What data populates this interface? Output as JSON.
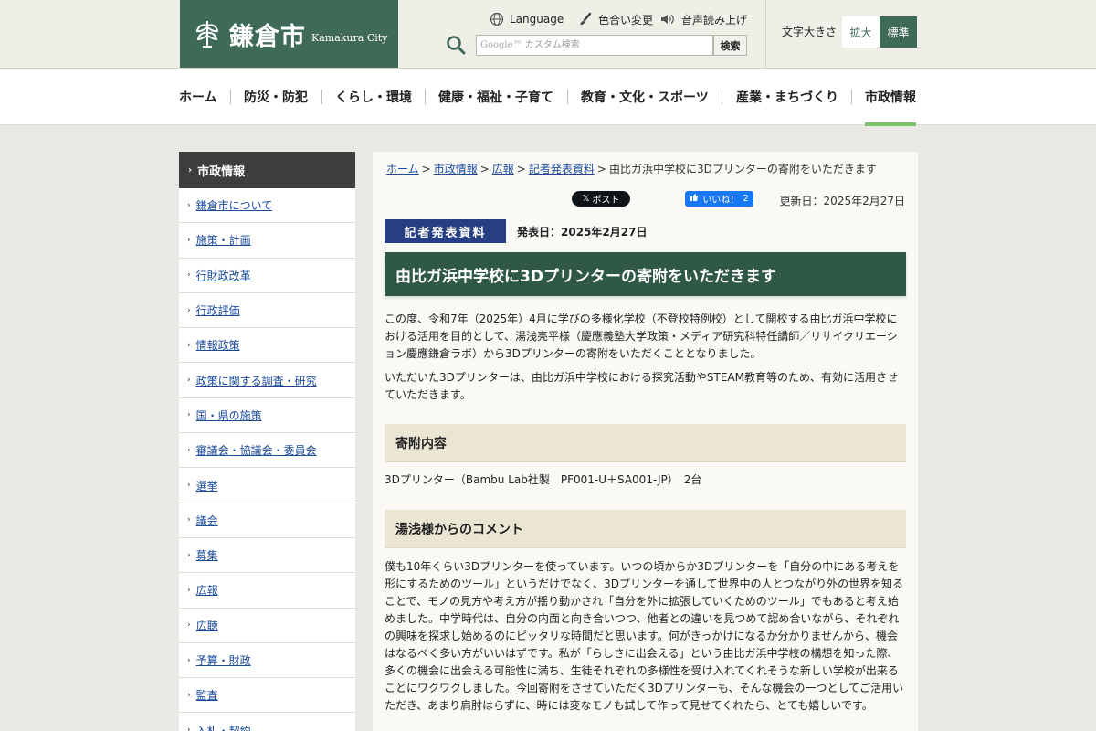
{
  "header": {
    "logo_jp": "鎌倉市",
    "logo_en": "Kamakura City",
    "language": "Language",
    "color_change": "色合い変更",
    "voice_read": "音声読み上げ",
    "search_placeholder": "カスタム検索",
    "search_google_mark": "Google™",
    "search_button": "検索",
    "font_size_label": "文字大きさ",
    "font_large": "拡大",
    "font_standard": "標準"
  },
  "nav": {
    "items": [
      "ホーム",
      "防災・防犯",
      "くらし・環境",
      "健康・福祉・子育て",
      "教育・文化・スポーツ",
      "産業・まちづくり",
      "市政情報"
    ],
    "active": "市政情報",
    "active_color": "#7cc26a"
  },
  "sidebar": {
    "heading": "市政情報",
    "items": [
      "鎌倉市について",
      "施策・計画",
      "行財政改革",
      "行政評価",
      "情報政策",
      "政策に関する調査・研究",
      "国・県の施策",
      "審議会・協議会・委員会",
      "選挙",
      "議会",
      "募集",
      "広報",
      "広聴",
      "予算・財政",
      "監査",
      "入札・契約"
    ]
  },
  "breadcrumb": {
    "items": [
      "ホーム",
      "市政情報",
      "広報",
      "記者発表資料"
    ],
    "current": "由比ガ浜中学校に3Dプリンターの寄附をいただきます",
    "sep": ">"
  },
  "social": {
    "x_post": "ポスト",
    "x_mark": "𝕏",
    "fb_like": "いいね！",
    "fb_count": "2"
  },
  "updated": "更新日：2025年2月27日",
  "press_badge": "記者発表資料",
  "announce_date": "発表日：2025年2月27日",
  "title": "由比ガ浜中学校に3Dプリンターの寄附をいただきます",
  "body": {
    "p1": "この度、令和7年（2025年）4月に学びの多様化学校（不登校特例校）として開校する由比ガ浜中学校における活用を目的として、湯浅亮平様（慶應義塾大学政策・メディア研究科特任講師／リサイクリエーション慶應鎌倉ラボ）から3Dプリンターの寄附をいただくこととなりました。",
    "p2": "いただいた3Dプリンターは、由比ガ浜中学校における探究活動やSTEAM教育等のため、有効に活用させていただきます。",
    "section1_head": "寄附内容",
    "section1_text": "3Dプリンター（Bambu Lab社製　PF001-U＋SA001-JP）　2台",
    "section2_head": "湯浅様からのコメント",
    "section2_text": "僕も10年くらい3Dプリンターを使っています。いつの頃からか3Dプリンターを「自分の中にある考えを形にするためのツール」というだけでなく、3Dプリンターを通して世界中の人とつながり外の世界を知ることで、モノの見方や考え方が揺り動かされ「自分を外に拡張していくためのツール」でもあると考え始めました。中学時代は、自分の内面と向き合いつつ、他者との違いを見つめて認め合いながら、それぞれの興味を探求し始めるのにピッタリな時間だと思います。何がきっかけになるか分かりませんから、機会はなるべく多い方がいいはずです。私が「らしさに出会える」という由比ガ浜中学校の構想を知った際、多くの機会に出会える可能性に満ち、生徒それぞれの多様性を受け入れてくれそうな新しい学校が出来ることにワクワクしました。今回寄附をさせていただく3Dプリンターも、そんな機会の一つとしてご活用いただき、あまり肩肘はらずに、時には変なモノも試して作って見せてくれたら、とても嬉しいです。"
  },
  "colors": {
    "brand_green": "#3f6a58",
    "title_green": "#2f5946",
    "press_navy": "#263e82",
    "link_blue": "#1a4a9a"
  }
}
